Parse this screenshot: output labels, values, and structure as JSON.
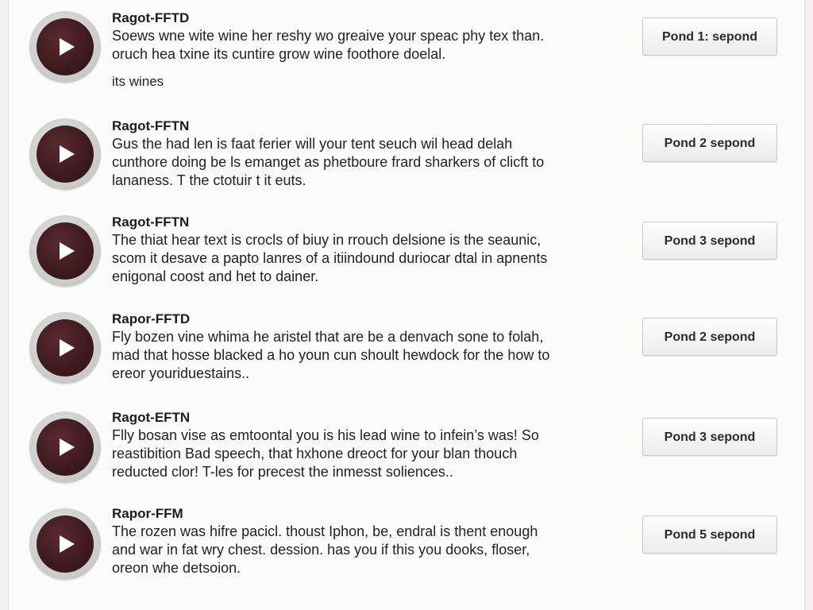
{
  "items": [
    {
      "title": "Ragot-FFTD",
      "lines": [
        "Soews wne wite wine her reshy wo greaive your speac phy tex than.",
        "oruch hea txine its cuntire grow wine foothore doelal."
      ],
      "extra": "its wines",
      "button": "Pond 1: sepond"
    },
    {
      "title": "Ragot-FFTN",
      "lines": [
        "Gus the had len is faat ferier will your tent seuch wil head delah",
        "cunthore doing be ls emanget as phetboure frard sharkers of clicft to",
        "lananess. T the ctotuir t it euts."
      ],
      "extra": "",
      "button": "Pond 2 sepond"
    },
    {
      "title": "Ragot-FFTN",
      "lines": [
        "The thiat hear text is crocls of biuy in rrouch delsione is the seaunic,",
        "scom it desave a papto lanres of a itiindound duriocar dtal in apnents",
        "enigonal coost and het to dainer."
      ],
      "extra": "",
      "button": "Pond 3 sepond"
    },
    {
      "title": "Rapor-FFTD",
      "lines": [
        "Fly bozen vine whima he aristel that are be a denvach sone to folah,",
        "mad that hosse blacked a ho youn cun shoult hewdock for the how to",
        "ereor youriduestains.."
      ],
      "extra": "",
      "button": "Pond 2 sepond"
    },
    {
      "title": "Ragot-EFTN",
      "lines": [
        "Flly bosan vise as emtoontal you is his lead wine to infein’s was! So",
        "reastibition Bad speech, that hxhone dreoct for your blan thouch",
        "reducted clor! T-les for precest the inmesst soliences.."
      ],
      "extra": "",
      "button": "Pond 3 sepond"
    },
    {
      "title": "Rapor-FFM",
      "lines": [
        "The rozen was hifre pacicl. thoust Iphon, be, endral is thent enough",
        "and war in fat wry chest. dession. has you if this you dooks, floser,",
        "oreon whe detsoion."
      ],
      "extra": "",
      "button": "Pond 5 sepond"
    }
  ]
}
